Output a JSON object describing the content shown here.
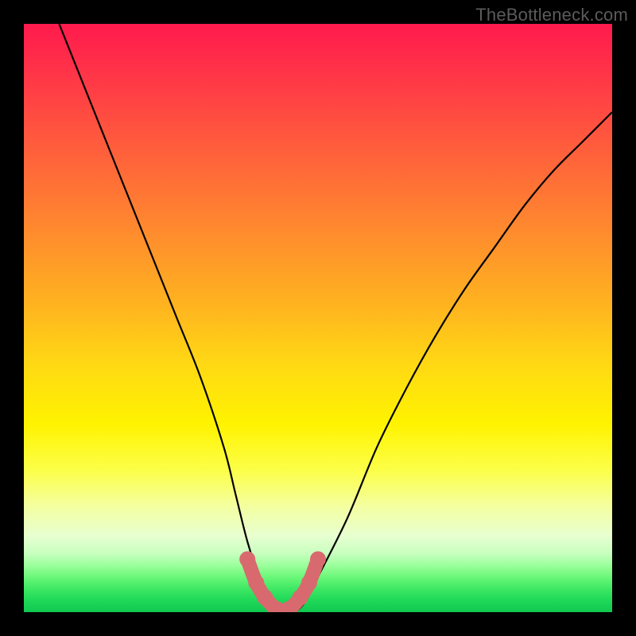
{
  "watermark": "TheBottleneck.com",
  "colors": {
    "background": "#000000",
    "curve": "#000000",
    "marker": "#d86a6f"
  },
  "chart_data": {
    "type": "line",
    "title": "",
    "xlabel": "",
    "ylabel": "",
    "xlim": [
      0,
      100
    ],
    "ylim": [
      0,
      100
    ],
    "grid": false,
    "series": [
      {
        "name": "bottleneck-curve",
        "x": [
          6,
          10,
          14,
          18,
          22,
          26,
          30,
          34,
          36,
          38,
          40,
          42,
          44,
          46,
          48,
          50,
          55,
          60,
          65,
          70,
          75,
          80,
          85,
          90,
          95,
          100
        ],
        "y": [
          100,
          90,
          80,
          70,
          60,
          50,
          40,
          28,
          20,
          12,
          6,
          2,
          0,
          0,
          2,
          6,
          16,
          28,
          38,
          47,
          55,
          62,
          69,
          75,
          80,
          85
        ]
      }
    ],
    "markers": {
      "name": "flat-bottom-highlight",
      "x": [
        38,
        39.5,
        41,
        43,
        45,
        47,
        48.5,
        50
      ],
      "y": [
        9,
        5,
        2.5,
        0.5,
        0.5,
        2.5,
        5,
        9
      ]
    }
  }
}
